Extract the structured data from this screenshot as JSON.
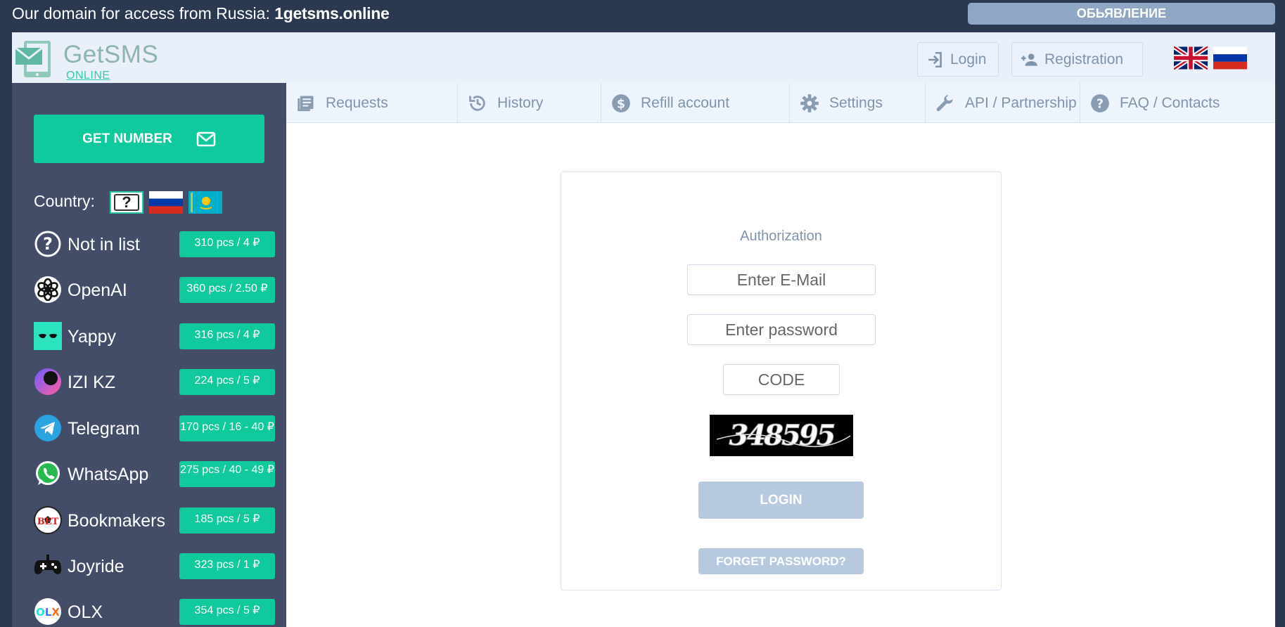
{
  "topbar": {
    "message_prefix": "Our domain for access from Russia: ",
    "message_domain": "1getsms.online",
    "announce_label": "ОБЬЯВЛЕНИЕ"
  },
  "header": {
    "logo_name": "GetSMS",
    "logo_sub": "ONLINE",
    "login_label": "Login",
    "registration_label": "Registration"
  },
  "sidebar": {
    "get_number_label": "GET NUMBER",
    "country_label": "Country:",
    "services": [
      {
        "name": "Not in list",
        "price": "310 pcs / 4 ₽"
      },
      {
        "name": "OpenAI",
        "price": "360 pcs / 2.50 ₽"
      },
      {
        "name": "Yappy",
        "price": "316 pcs / 4 ₽"
      },
      {
        "name": "IZI KZ",
        "price": "224 pcs / 5 ₽"
      },
      {
        "name": "Telegram",
        "price": "170 pcs / 16 - 40 ₽"
      },
      {
        "name": "WhatsApp",
        "price": "275 pcs / 40 - 49 ₽"
      },
      {
        "name": "Bookmakers",
        "price": "185 pcs / 5 ₽"
      },
      {
        "name": "Joyride",
        "price": "323 pcs / 1 ₽"
      },
      {
        "name": "OLX",
        "price": "354 pcs / 5 ₽"
      }
    ]
  },
  "nav": {
    "tabs": [
      {
        "label": "Requests"
      },
      {
        "label": "History"
      },
      {
        "label": "Refill account"
      },
      {
        "label": "Settings"
      },
      {
        "label": "API / Partnership"
      },
      {
        "label": "FAQ / Contacts"
      }
    ]
  },
  "auth": {
    "title": "Authorization",
    "email_placeholder": "Enter E-Mail",
    "password_placeholder": "Enter password",
    "code_placeholder": "CODE",
    "captcha_text": "348595",
    "login_label": "LOGIN",
    "forget_label": "FORGET PASSWORD?"
  },
  "colors": {
    "accent": "#10c99c",
    "sidebar": "#434d67",
    "topbar": "#2a3950",
    "muted_button": "#b6c9de"
  }
}
